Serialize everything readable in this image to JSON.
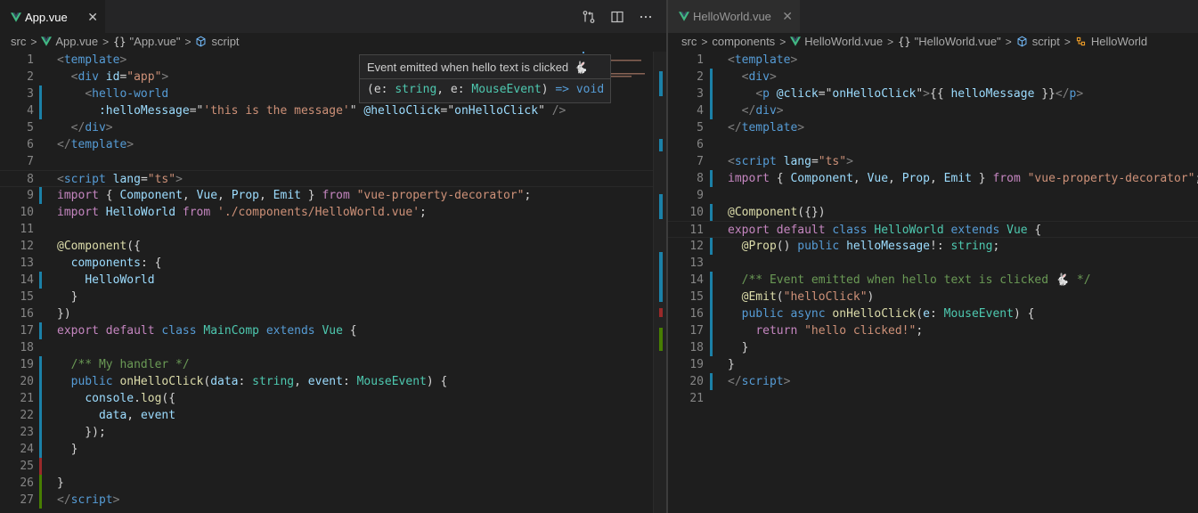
{
  "left": {
    "tab": {
      "label": "App.vue",
      "close": "✕"
    },
    "actions": [
      "compare-changes-icon",
      "split-editor-icon",
      "more-actions-icon"
    ],
    "breadcrumb": {
      "src": "src",
      "file": "App.vue",
      "brace": "{}",
      "object": "\"App.vue\"",
      "script": "script"
    },
    "lines": [
      {
        "n": "1",
        "t": [
          [
            "t-tagp",
            "<"
          ],
          [
            "t-tag",
            "template"
          ],
          [
            "t-tagp",
            ">"
          ]
        ]
      },
      {
        "n": "2",
        "t": [
          [
            "t-pun",
            "  "
          ],
          [
            "t-tagp",
            "<"
          ],
          [
            "t-tag",
            "div"
          ],
          [
            "t-pun",
            " "
          ],
          [
            "t-attr",
            "id"
          ],
          [
            "t-pun",
            "="
          ],
          [
            "t-str",
            "\"app\""
          ],
          [
            "t-tagp",
            ">"
          ]
        ]
      },
      {
        "n": "3",
        "t": [
          [
            "t-pun",
            "    "
          ],
          [
            "t-tagp",
            "<"
          ],
          [
            "t-tag",
            "hello-world"
          ]
        ]
      },
      {
        "n": "4",
        "t": [
          [
            "t-pun",
            "      "
          ],
          [
            "t-attr",
            ":helloMessage"
          ],
          [
            "t-pun",
            "=\""
          ],
          [
            "t-str",
            "'this is the message'"
          ],
          [
            "t-pun",
            "\" "
          ],
          [
            "t-attr",
            "@helloClick"
          ],
          [
            "t-pun",
            "=\""
          ],
          [
            "t-var",
            "onHelloClick"
          ],
          [
            "t-pun",
            "\" "
          ],
          [
            "t-tagp",
            "/>"
          ]
        ]
      },
      {
        "n": "5",
        "t": [
          [
            "t-pun",
            "  "
          ],
          [
            "t-tagp",
            "</"
          ],
          [
            "t-tag",
            "div"
          ],
          [
            "t-tagp",
            ">"
          ]
        ]
      },
      {
        "n": "6",
        "t": [
          [
            "t-tagp",
            "</"
          ],
          [
            "t-tag",
            "template"
          ],
          [
            "t-tagp",
            ">"
          ]
        ]
      },
      {
        "n": "7",
        "t": []
      },
      {
        "n": "8",
        "t": [
          [
            "t-tagp",
            "<"
          ],
          [
            "t-tag",
            "script"
          ],
          [
            "t-pun",
            " "
          ],
          [
            "t-attr",
            "lang"
          ],
          [
            "t-pun",
            "="
          ],
          [
            "t-str",
            "\"ts\""
          ],
          [
            "t-tagp",
            ">"
          ]
        ]
      },
      {
        "n": "9",
        "t": [
          [
            "t-ctrl",
            "import"
          ],
          [
            "t-pun",
            " { "
          ],
          [
            "t-var",
            "Component"
          ],
          [
            "t-pun",
            ", "
          ],
          [
            "t-var",
            "Vue"
          ],
          [
            "t-pun",
            ", "
          ],
          [
            "t-var",
            "Prop"
          ],
          [
            "t-pun",
            ", "
          ],
          [
            "t-var",
            "Emit"
          ],
          [
            "t-pun",
            " } "
          ],
          [
            "t-ctrl",
            "from"
          ],
          [
            "t-pun",
            " "
          ],
          [
            "t-str",
            "\"vue-property-decorator\""
          ],
          [
            "t-pun",
            ";"
          ]
        ]
      },
      {
        "n": "10",
        "t": [
          [
            "t-ctrl",
            "import"
          ],
          [
            "t-pun",
            " "
          ],
          [
            "t-var",
            "HelloWorld"
          ],
          [
            "t-pun",
            " "
          ],
          [
            "t-ctrl",
            "from"
          ],
          [
            "t-pun",
            " "
          ],
          [
            "t-str",
            "'./components/HelloWorld.vue'"
          ],
          [
            "t-pun",
            ";"
          ]
        ]
      },
      {
        "n": "11",
        "t": []
      },
      {
        "n": "12",
        "t": [
          [
            "t-fn",
            "@Component"
          ],
          [
            "t-pun",
            "({"
          ]
        ]
      },
      {
        "n": "13",
        "t": [
          [
            "t-pun",
            "  "
          ],
          [
            "t-var",
            "components"
          ],
          [
            "t-pun",
            ": {"
          ]
        ]
      },
      {
        "n": "14",
        "t": [
          [
            "t-pun",
            "    "
          ],
          [
            "t-var",
            "HelloWorld"
          ]
        ]
      },
      {
        "n": "15",
        "t": [
          [
            "t-pun",
            "  }"
          ]
        ]
      },
      {
        "n": "16",
        "t": [
          [
            "t-pun",
            "})"
          ]
        ]
      },
      {
        "n": "17",
        "t": [
          [
            "t-ctrl",
            "export"
          ],
          [
            "t-pun",
            " "
          ],
          [
            "t-ctrl",
            "default"
          ],
          [
            "t-pun",
            " "
          ],
          [
            "t-kw",
            "class"
          ],
          [
            "t-pun",
            " "
          ],
          [
            "t-cls",
            "MainComp"
          ],
          [
            "t-pun",
            " "
          ],
          [
            "t-kw",
            "extends"
          ],
          [
            "t-pun",
            " "
          ],
          [
            "t-cls",
            "Vue"
          ],
          [
            "t-pun",
            " {"
          ]
        ]
      },
      {
        "n": "18",
        "t": []
      },
      {
        "n": "19",
        "t": [
          [
            "t-pun",
            "  "
          ],
          [
            "t-com",
            "/** My handler */"
          ]
        ]
      },
      {
        "n": "20",
        "t": [
          [
            "t-pun",
            "  "
          ],
          [
            "t-kw",
            "public"
          ],
          [
            "t-pun",
            " "
          ],
          [
            "t-fn",
            "onHelloClick"
          ],
          [
            "t-pun",
            "("
          ],
          [
            "t-var",
            "data"
          ],
          [
            "t-pun",
            ": "
          ],
          [
            "t-cls",
            "string"
          ],
          [
            "t-pun",
            ", "
          ],
          [
            "t-var",
            "event"
          ],
          [
            "t-pun",
            ": "
          ],
          [
            "t-cls",
            "MouseEvent"
          ],
          [
            "t-pun",
            ") {"
          ]
        ]
      },
      {
        "n": "21",
        "t": [
          [
            "t-pun",
            "    "
          ],
          [
            "t-var",
            "console"
          ],
          [
            "t-pun",
            "."
          ],
          [
            "t-fn",
            "log"
          ],
          [
            "t-pun",
            "({"
          ]
        ]
      },
      {
        "n": "22",
        "t": [
          [
            "t-pun",
            "      "
          ],
          [
            "t-var",
            "data"
          ],
          [
            "t-pun",
            ", "
          ],
          [
            "t-var",
            "event"
          ]
        ]
      },
      {
        "n": "23",
        "t": [
          [
            "t-pun",
            "    });"
          ]
        ]
      },
      {
        "n": "24",
        "t": [
          [
            "t-pun",
            "  }"
          ]
        ]
      },
      {
        "n": "25",
        "t": []
      },
      {
        "n": "26",
        "t": [
          [
            "t-pun",
            "}"
          ]
        ]
      },
      {
        "n": "27",
        "t": [
          [
            "t-tagp",
            "</"
          ],
          [
            "t-tag",
            "script"
          ],
          [
            "t-tagp",
            ">"
          ]
        ]
      }
    ],
    "hover": {
      "doc": "Event emitted when hello text is clicked",
      "emoji": "🐇",
      "sig": [
        [
          "t-pun",
          "(e: "
        ],
        [
          "t-cls",
          "string"
        ],
        [
          "t-pun",
          ", e: "
        ],
        [
          "t-cls",
          "MouseEvent"
        ],
        [
          "t-pun",
          ") "
        ],
        [
          "t-kw",
          "=> void"
        ]
      ]
    }
  },
  "right": {
    "tab": {
      "label": "HelloWorld.vue",
      "close": "✕"
    },
    "breadcrumb": {
      "src": "src",
      "components": "components",
      "file": "HelloWorld.vue",
      "brace": "{}",
      "object": "\"HelloWorld.vue\"",
      "script": "script",
      "symbol": "HelloWorld"
    },
    "lines": [
      {
        "n": "1",
        "t": [
          [
            "t-tagp",
            "<"
          ],
          [
            "t-tag",
            "template"
          ],
          [
            "t-tagp",
            ">"
          ]
        ]
      },
      {
        "n": "2",
        "t": [
          [
            "t-pun",
            "  "
          ],
          [
            "t-tagp",
            "<"
          ],
          [
            "t-tag",
            "div"
          ],
          [
            "t-tagp",
            ">"
          ]
        ]
      },
      {
        "n": "3",
        "t": [
          [
            "t-pun",
            "    "
          ],
          [
            "t-tagp",
            "<"
          ],
          [
            "t-tag",
            "p"
          ],
          [
            "t-pun",
            " "
          ],
          [
            "t-attr",
            "@click"
          ],
          [
            "t-pun",
            "=\""
          ],
          [
            "t-var",
            "onHelloClick"
          ],
          [
            "t-pun",
            "\""
          ],
          [
            "t-tagp",
            ">"
          ],
          [
            "t-pun",
            "{{ "
          ],
          [
            "t-var",
            "helloMessage"
          ],
          [
            "t-pun",
            " }}"
          ],
          [
            "t-tagp",
            "</"
          ],
          [
            "t-tag",
            "p"
          ],
          [
            "t-tagp",
            ">"
          ]
        ]
      },
      {
        "n": "4",
        "t": [
          [
            "t-pun",
            "  "
          ],
          [
            "t-tagp",
            "</"
          ],
          [
            "t-tag",
            "div"
          ],
          [
            "t-tagp",
            ">"
          ]
        ]
      },
      {
        "n": "5",
        "t": [
          [
            "t-tagp",
            "</"
          ],
          [
            "t-tag",
            "template"
          ],
          [
            "t-tagp",
            ">"
          ]
        ]
      },
      {
        "n": "6",
        "t": []
      },
      {
        "n": "7",
        "t": [
          [
            "t-tagp",
            "<"
          ],
          [
            "t-tag",
            "script"
          ],
          [
            "t-pun",
            " "
          ],
          [
            "t-attr",
            "lang"
          ],
          [
            "t-pun",
            "="
          ],
          [
            "t-str",
            "\"ts\""
          ],
          [
            "t-tagp",
            ">"
          ]
        ]
      },
      {
        "n": "8",
        "t": [
          [
            "t-ctrl",
            "import"
          ],
          [
            "t-pun",
            " { "
          ],
          [
            "t-var",
            "Component"
          ],
          [
            "t-pun",
            ", "
          ],
          [
            "t-var",
            "Vue"
          ],
          [
            "t-pun",
            ", "
          ],
          [
            "t-var",
            "Prop"
          ],
          [
            "t-pun",
            ", "
          ],
          [
            "t-var",
            "Emit"
          ],
          [
            "t-pun",
            " } "
          ],
          [
            "t-ctrl",
            "from"
          ],
          [
            "t-pun",
            " "
          ],
          [
            "t-str",
            "\"vue-property-decorator\""
          ],
          [
            "t-pun",
            ";"
          ]
        ]
      },
      {
        "n": "9",
        "t": []
      },
      {
        "n": "10",
        "t": [
          [
            "t-fn",
            "@Component"
          ],
          [
            "t-pun",
            "({})"
          ]
        ]
      },
      {
        "n": "11",
        "t": [
          [
            "t-ctrl",
            "export"
          ],
          [
            "t-pun",
            " "
          ],
          [
            "t-ctrl",
            "default"
          ],
          [
            "t-pun",
            " "
          ],
          [
            "t-kw",
            "class"
          ],
          [
            "t-pun",
            " "
          ],
          [
            "t-cls",
            "HelloWorld"
          ],
          [
            "t-pun",
            " "
          ],
          [
            "t-kw",
            "extends"
          ],
          [
            "t-pun",
            " "
          ],
          [
            "t-cls",
            "Vue"
          ],
          [
            "t-pun",
            " {"
          ]
        ]
      },
      {
        "n": "12",
        "t": [
          [
            "t-pun",
            "  "
          ],
          [
            "t-fn",
            "@Prop"
          ],
          [
            "t-pun",
            "() "
          ],
          [
            "t-kw",
            "public"
          ],
          [
            "t-pun",
            " "
          ],
          [
            "t-var",
            "helloMessage"
          ],
          [
            "t-pun",
            "!: "
          ],
          [
            "t-cls",
            "string"
          ],
          [
            "t-pun",
            ";"
          ]
        ]
      },
      {
        "n": "13",
        "t": []
      },
      {
        "n": "14",
        "t": [
          [
            "t-pun",
            "  "
          ],
          [
            "t-com",
            "/** Event emitted when hello text is clicked 🐇 */"
          ]
        ]
      },
      {
        "n": "15",
        "t": [
          [
            "t-pun",
            "  "
          ],
          [
            "t-fn",
            "@Emit"
          ],
          [
            "t-pun",
            "("
          ],
          [
            "t-str",
            "\"helloClick\""
          ],
          [
            "t-pun",
            ")"
          ]
        ]
      },
      {
        "n": "16",
        "t": [
          [
            "t-pun",
            "  "
          ],
          [
            "t-kw",
            "public"
          ],
          [
            "t-pun",
            " "
          ],
          [
            "t-kw",
            "async"
          ],
          [
            "t-pun",
            " "
          ],
          [
            "t-fn",
            "onHelloClick"
          ],
          [
            "t-pun",
            "("
          ],
          [
            "t-var",
            "e"
          ],
          [
            "t-pun",
            ": "
          ],
          [
            "t-cls",
            "MouseEvent"
          ],
          [
            "t-pun",
            ") {"
          ]
        ]
      },
      {
        "n": "17",
        "t": [
          [
            "t-pun",
            "    "
          ],
          [
            "t-ctrl",
            "return"
          ],
          [
            "t-pun",
            " "
          ],
          [
            "t-str",
            "\"hello clicked!\""
          ],
          [
            "t-pun",
            ";"
          ]
        ]
      },
      {
        "n": "18",
        "t": [
          [
            "t-pun",
            "  }"
          ]
        ]
      },
      {
        "n": "19",
        "t": [
          [
            "t-pun",
            "}"
          ]
        ]
      },
      {
        "n": "20",
        "t": [
          [
            "t-tagp",
            "</"
          ],
          [
            "t-tag",
            "script"
          ],
          [
            "t-tagp",
            ">"
          ]
        ]
      },
      {
        "n": "21",
        "t": []
      }
    ]
  },
  "colors": {
    "gutter_modified": "#1b81a8",
    "gutter_added": "#487e02",
    "gutter_deleted": "#9a2a2a"
  }
}
